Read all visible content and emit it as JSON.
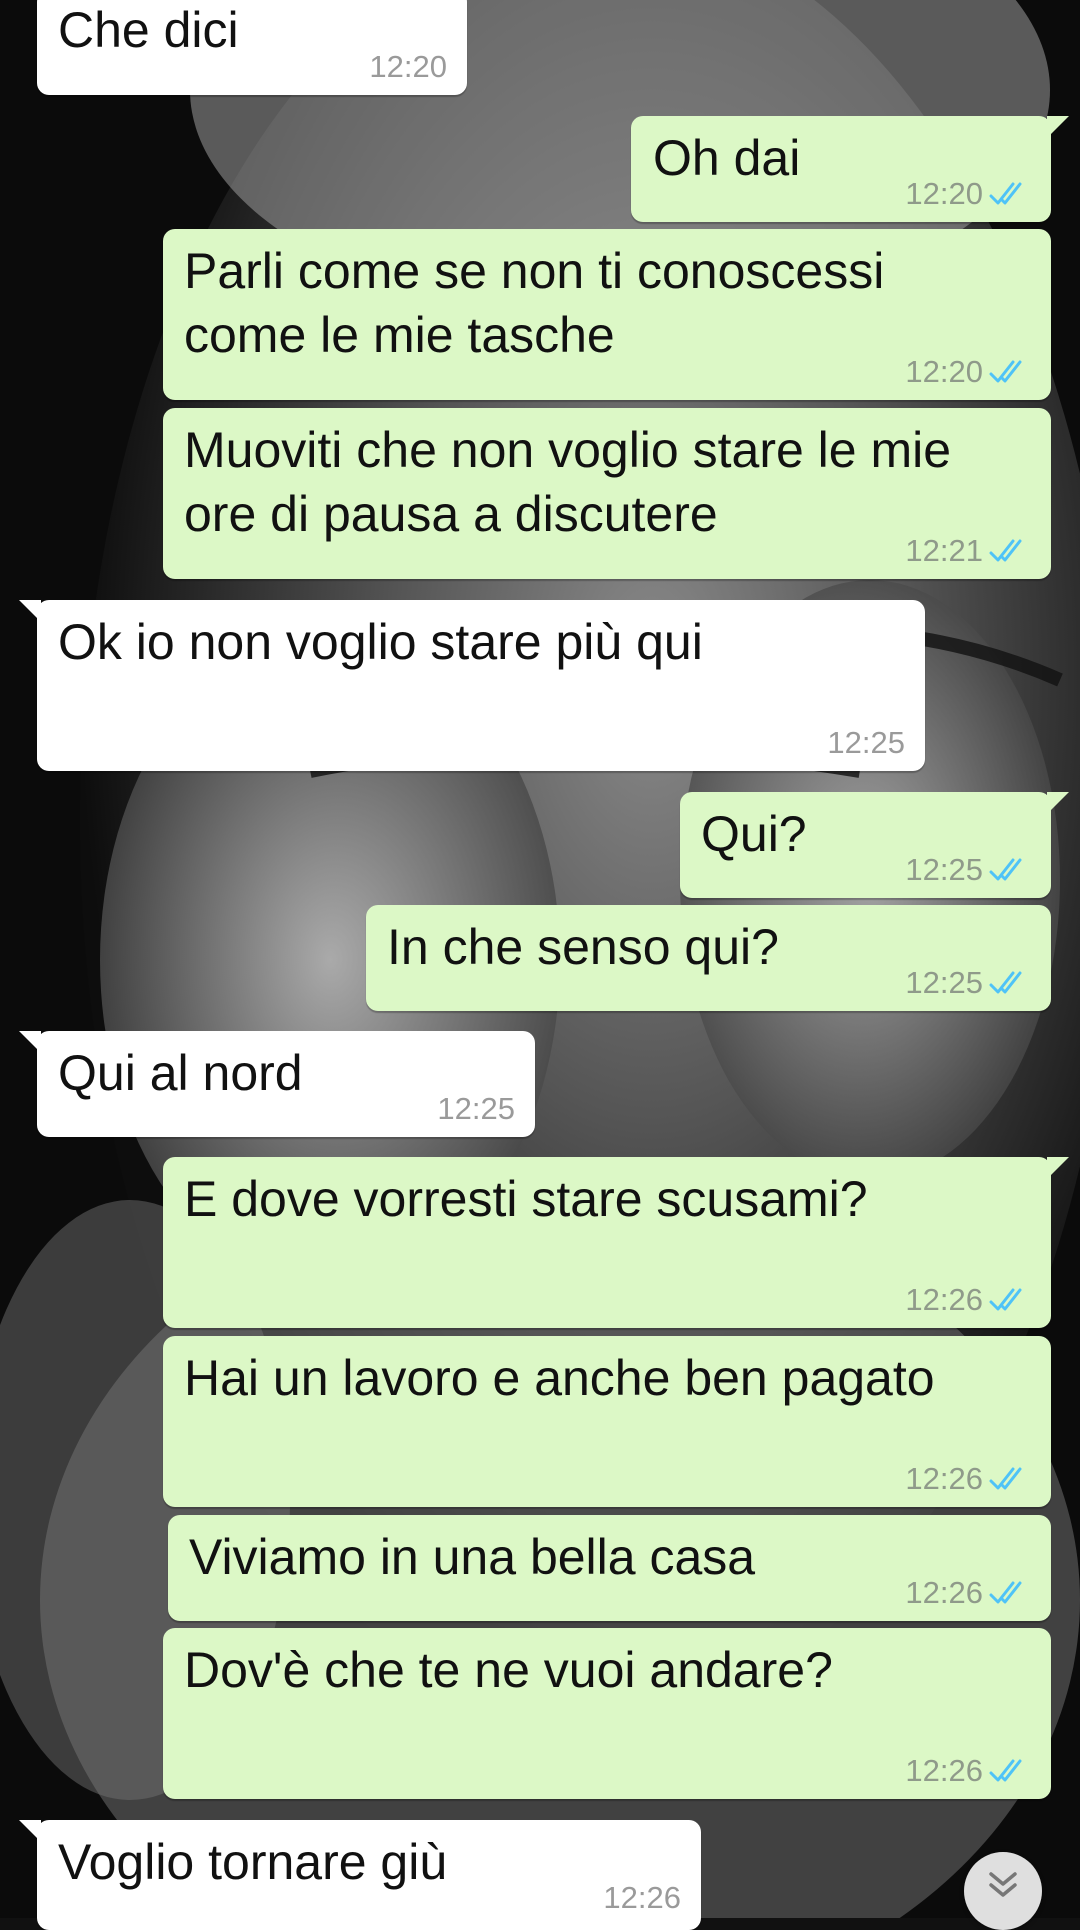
{
  "chat": {
    "messages": [
      {
        "direction": "in",
        "text": "Che dici",
        "time": "12:20"
      },
      {
        "direction": "out",
        "text": "Oh dai",
        "time": "12:20",
        "status": "read"
      },
      {
        "direction": "out",
        "text": "Parli come se non ti conoscessi\ncome le mie tasche",
        "time": "12:20",
        "status": "read"
      },
      {
        "direction": "out",
        "text": "Muoviti che non voglio stare le mie\nore di pausa a discutere",
        "time": "12:21",
        "status": "read"
      },
      {
        "direction": "in",
        "text": "Ok io non voglio stare più qui",
        "time": "12:25"
      },
      {
        "direction": "out",
        "text": "Qui?",
        "time": "12:25",
        "status": "read"
      },
      {
        "direction": "out",
        "text": "In che senso qui?",
        "time": "12:25",
        "status": "read"
      },
      {
        "direction": "in",
        "text": "Qui al nord",
        "time": "12:25"
      },
      {
        "direction": "out",
        "text": "E dove vorresti stare scusami?",
        "time": "12:26",
        "status": "read"
      },
      {
        "direction": "out",
        "text": "Hai un lavoro e anche ben pagato",
        "time": "12:26",
        "status": "read"
      },
      {
        "direction": "out",
        "text": "Viviamo in una bella casa",
        "time": "12:26",
        "status": "read"
      },
      {
        "direction": "out",
        "text": "Dov'è che te ne vuoi andare?",
        "time": "12:26",
        "status": "read"
      },
      {
        "direction": "in",
        "text": "Voglio tornare giù",
        "time": "12:26"
      }
    ]
  },
  "icons": {
    "read_receipt": "double-check-icon",
    "scroll_down": "chevron-double-down-icon"
  },
  "colors": {
    "incoming_bubble": "#ffffff",
    "outgoing_bubble": "#dcf8c6",
    "read_ticks": "#4fc3f7",
    "timestamp": "#8f9a8a"
  }
}
